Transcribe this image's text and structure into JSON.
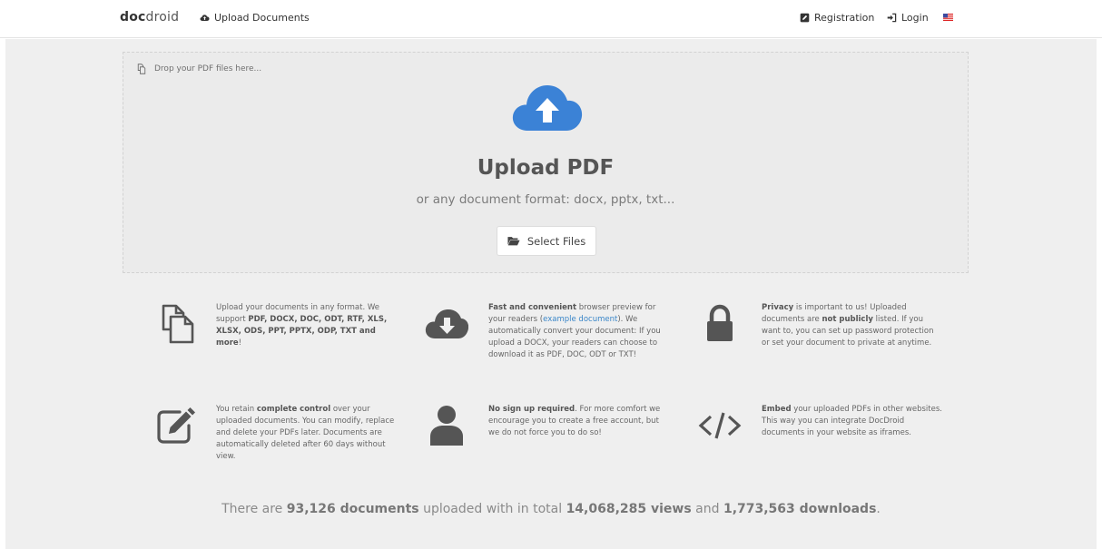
{
  "nav": {
    "brand_bold": "doc",
    "brand_rest": "droid",
    "upload_label": "Upload Documents",
    "registration_label": "Registration",
    "login_label": "Login",
    "flag": "us-flag-icon"
  },
  "dropzone": {
    "hint": "Drop your PDF files here...",
    "title": "Upload PDF",
    "subtitle": "or any document format: docx, pptx, txt...",
    "select_button": "Select Files",
    "accent_color": "#3b82d6"
  },
  "features": [
    {
      "icon": "copy-icon",
      "parts": [
        {
          "t": "Upload your documents in any format. We support "
        },
        {
          "t": "PDF, DOCX, DOC, ODT, RTF, XLS, XLSX, ODS, PPT, PPTX, ODP, TXT and more",
          "b": true
        },
        {
          "t": "!"
        }
      ]
    },
    {
      "icon": "cloud-download-icon",
      "parts": [
        {
          "t": "Fast and convenient",
          "b": true
        },
        {
          "t": " browser preview for your readers ("
        },
        {
          "t": "example document",
          "a": true
        },
        {
          "t": "). We automatically convert your document: If you upload a DOCX, your readers can choose to download it as PDF, DOC, ODT or TXT!"
        }
      ]
    },
    {
      "icon": "lock-icon",
      "parts": [
        {
          "t": "Privacy",
          "b": true
        },
        {
          "t": " is important to us! Uploaded documents are "
        },
        {
          "t": "not publicly",
          "b": true
        },
        {
          "t": " listed. If you want to, you can set up password protection or set your document to private at anytime."
        }
      ]
    },
    {
      "icon": "edit-icon",
      "parts": [
        {
          "t": "You retain "
        },
        {
          "t": "complete control",
          "b": true
        },
        {
          "t": " over your uploaded documents. You can modify, replace and delete your PDFs later. Documents are automatically deleted after 60 days without view."
        }
      ]
    },
    {
      "icon": "user-icon",
      "parts": [
        {
          "t": "No sign up required",
          "b": true
        },
        {
          "t": ". For more comfort we encourage you to create a free account, but we do not force you to do so!"
        }
      ]
    },
    {
      "icon": "code-icon",
      "parts": [
        {
          "t": "Embed",
          "b": true
        },
        {
          "t": " your uploaded PDFs in other websites. This way you can integrate DocDroid documents in your website as iframes."
        }
      ]
    }
  ],
  "stats": {
    "prefix": "There are ",
    "documents": "93,126 documents",
    "mid1": " uploaded with in total ",
    "views": "14,068,285 views",
    "mid2": " and ",
    "downloads": "1,773,563 downloads",
    "suffix": "."
  }
}
